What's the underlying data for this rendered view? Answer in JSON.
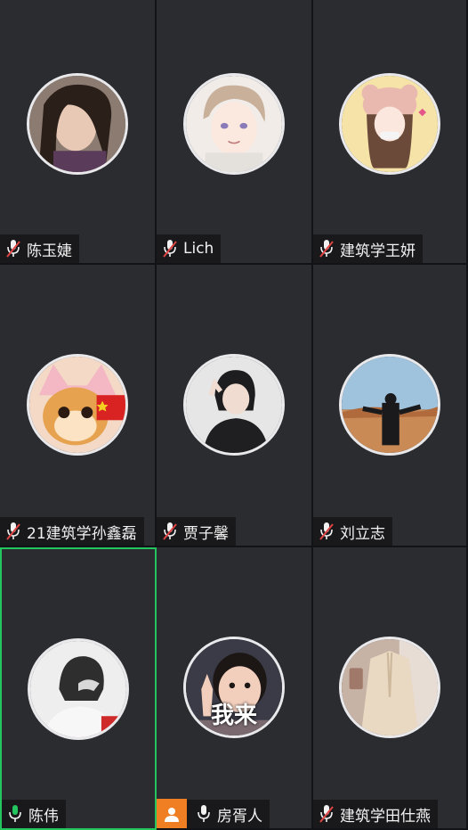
{
  "participants": [
    {
      "name": "陈玉婕",
      "mic": "muted"
    },
    {
      "name": "Lich",
      "mic": "muted"
    },
    {
      "name": "建筑学王妍",
      "mic": "muted"
    },
    {
      "name": "21建筑学孙鑫磊",
      "mic": "muted"
    },
    {
      "name": "贾子馨",
      "mic": "muted"
    },
    {
      "name": "刘立志",
      "mic": "muted"
    },
    {
      "name": "陈伟",
      "mic": "active",
      "speaking": true
    },
    {
      "name": "房胥人",
      "mic": "on",
      "avatar_text": "我来"
    },
    {
      "name": "建筑学田仕燕",
      "mic": "muted"
    }
  ],
  "colors": {
    "speaking_border": "#22c55e",
    "muted_mic": "#e04444",
    "active_mic": "#22c55e",
    "camera_button": "#f07e22"
  },
  "icons": {
    "muted": "mic-muted-icon",
    "active": "mic-active-icon",
    "on": "mic-icon",
    "camera": "person-camera-icon"
  }
}
